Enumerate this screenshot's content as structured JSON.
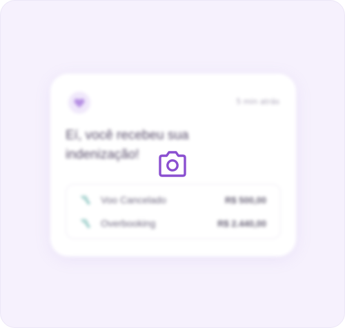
{
  "notification": {
    "time": "5 min atrás",
    "headline": "Eí, você recebeu sua indenização!",
    "items": [
      {
        "icon": "flight-cancel-icon",
        "label": "Voo Cancelado",
        "value": "R$ 500,00"
      },
      {
        "icon": "flight-cancel-icon",
        "label": "Overbooking",
        "value": "R$ 2.440,00"
      }
    ]
  },
  "icons": {
    "badge": "heart-icon",
    "overlay": "camera-icon"
  },
  "colors": {
    "background": "#f6f1fd",
    "card": "#ffffff",
    "accent_purple": "#8a4fd0",
    "heart": "#b58ee3",
    "plane_teal": "#6fb7b2",
    "text": "#5a4f6c"
  }
}
